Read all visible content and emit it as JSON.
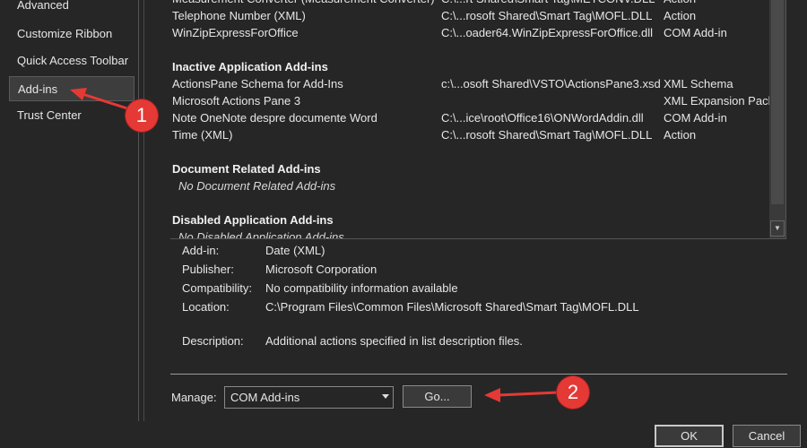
{
  "sidebar": {
    "items": [
      {
        "label": "Advanced"
      },
      {
        "label": "Customize Ribbon"
      },
      {
        "label": "Quick Access Toolbar"
      },
      {
        "label": "Add-ins"
      },
      {
        "label": "Trust Center"
      }
    ],
    "selected": "Add-ins"
  },
  "addins": {
    "top_rows": [
      {
        "name": "Measurement Converter (Measurement Converter)",
        "location": "C:\\...rt Shared\\Smart Tag\\METCONV.DLL",
        "type": "Action"
      },
      {
        "name": "Telephone Number (XML)",
        "location": "C:\\...rosoft Shared\\Smart Tag\\MOFL.DLL",
        "type": "Action"
      },
      {
        "name": "WinZipExpressForOffice",
        "location": "C:\\...oader64.WinZipExpressForOffice.dll",
        "type": "COM Add-in"
      }
    ],
    "inactive_header": "Inactive Application Add-ins",
    "inactive_rows": [
      {
        "name": "ActionsPane Schema for Add-Ins",
        "location": "c:\\...osoft Shared\\VSTO\\ActionsPane3.xsd",
        "type": "XML Schema"
      },
      {
        "name": "Microsoft Actions Pane 3",
        "location": "",
        "type": "XML Expansion Pack"
      },
      {
        "name": "Note OneNote despre documente Word",
        "location": "C:\\...ice\\root\\Office16\\ONWordAddin.dll",
        "type": "COM Add-in"
      },
      {
        "name": "Time (XML)",
        "location": "C:\\...rosoft Shared\\Smart Tag\\MOFL.DLL",
        "type": "Action"
      }
    ],
    "document_header": "Document Related Add-ins",
    "document_empty": "No Document Related Add-ins",
    "disabled_header": "Disabled Application Add-ins",
    "disabled_empty": "No Disabled Application Add-ins"
  },
  "details": {
    "addin_label": "Add-in:",
    "addin_value": "Date (XML)",
    "publisher_label": "Publisher:",
    "publisher_value": "Microsoft Corporation",
    "compat_label": "Compatibility:",
    "compat_value": "No compatibility information available",
    "location_label": "Location:",
    "location_value": "C:\\Program Files\\Common Files\\Microsoft Shared\\Smart Tag\\MOFL.DLL",
    "description_label": "Description:",
    "description_value": "Additional actions specified in list description files."
  },
  "manage": {
    "label": "Manage:",
    "selected": "COM Add-ins",
    "go_label": "Go..."
  },
  "footer": {
    "ok_label": "OK",
    "cancel_label": "Cancel"
  },
  "callouts": {
    "one": "1",
    "two": "2",
    "color": "#e53935"
  }
}
